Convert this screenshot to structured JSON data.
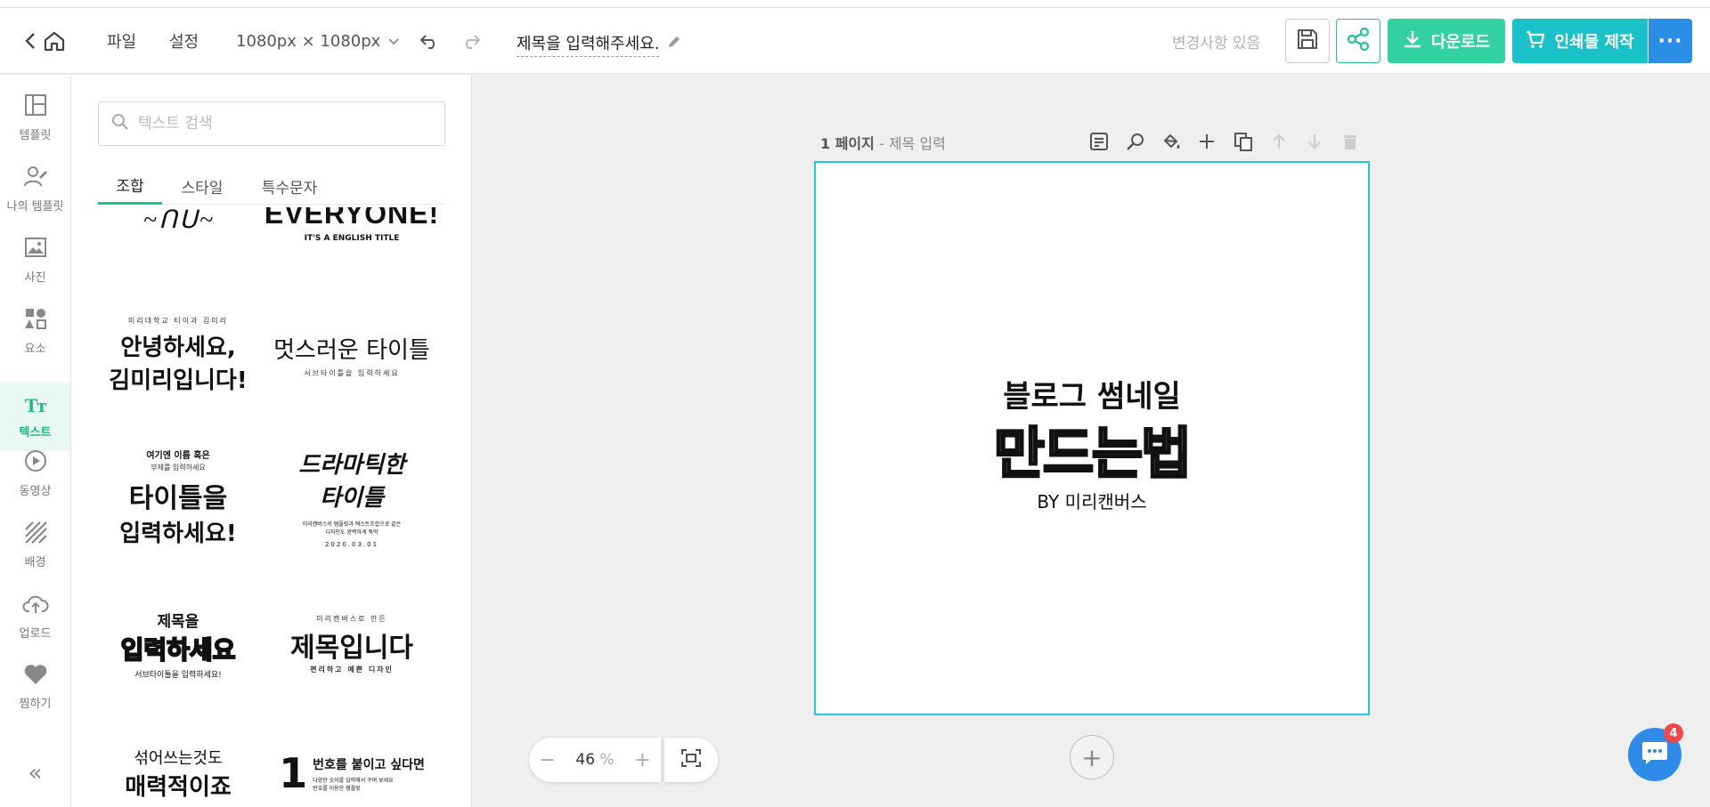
{
  "header": {
    "menu_file": "파일",
    "menu_settings": "설정",
    "size": "1080px × 1080px",
    "title": "제목을 입력해주세요.",
    "changes_status": "변경사항 있음",
    "download_label": "다운로드",
    "print_label": "인쇄물 제작",
    "more_label": "···"
  },
  "sidebar": {
    "items": [
      {
        "label": "템플릿",
        "icon": "template-icon"
      },
      {
        "label": "나의 템플릿",
        "icon": "my-template-icon"
      },
      {
        "label": "사진",
        "icon": "photo-icon"
      },
      {
        "label": "요소",
        "icon": "elements-icon"
      },
      {
        "label": "텍스트",
        "icon": "text-icon"
      },
      {
        "label": "동영상",
        "icon": "video-icon"
      },
      {
        "label": "배경",
        "icon": "background-icon"
      },
      {
        "label": "업로드",
        "icon": "upload-icon"
      },
      {
        "label": "찜하기",
        "icon": "heart-icon"
      }
    ],
    "active": "텍스트",
    "collapse_label": "«"
  },
  "panel": {
    "search_placeholder": "텍스트 검색",
    "tabs": [
      "조합",
      "스타일",
      "특수문자"
    ],
    "active_tab": "조합",
    "templates": {
      "t1_top": "EVERYONE!",
      "t1_sub": "IT'S A ENGLISH TITLE",
      "t2_small": "미리대학교 티이과 김미리",
      "t2_line1": "안녕하세요,",
      "t2_line2": "김미리입니다!",
      "t3_main": "멋스러운 타이틀",
      "t3_small": "서브타이틀을 입력하세요",
      "t4_small1": "여기엔 이름 혹은",
      "t4_small2": "부제를 입력하세요",
      "t4_line1": "타이틀을",
      "t4_line2": "입력하세요!",
      "t5_line1": "드라마틱한",
      "t5_line2": "타이틀",
      "t5_small1": "미리캔버스의 탬플릿과 텍스트조합으로 같은",
      "t5_small2": "디자인도 완벽하게 뚝딱",
      "t5_date": "2020.03.01",
      "t6_line1": "제목을",
      "t6_line2": "입력하세요",
      "t6_small": "서브타이틀을 입력하세요!",
      "t7_small": "미리캔버스로 만든",
      "t7_main": "제목입니다",
      "t7_sub": "편리하고 예쁜 디자인",
      "t8_line1": "섞어쓰는것도",
      "t8_line2": "매력적이죠",
      "t9_num": "1",
      "t9_main": "번호를 붙이고 싶다면",
      "t9_small1": "다양한 숫자를 입력해서 꾸며 보세요",
      "t9_small2": "번호를 이용한 템플릿"
    }
  },
  "canvas": {
    "page_label": "1 페이지",
    "page_sub": " - 제목 입력",
    "design_line1": "블로그 썸네일",
    "design_line2": "만드는법",
    "design_line3": "BY 미리캔버스",
    "zoom_value": "46",
    "zoom_unit": "%",
    "chat_badge": "4"
  },
  "colors": {
    "accent_green": "#33d2a0",
    "accent_teal": "#1ac1c9",
    "accent_blue": "#2a8ee6",
    "page_border": "#1fcad4"
  }
}
